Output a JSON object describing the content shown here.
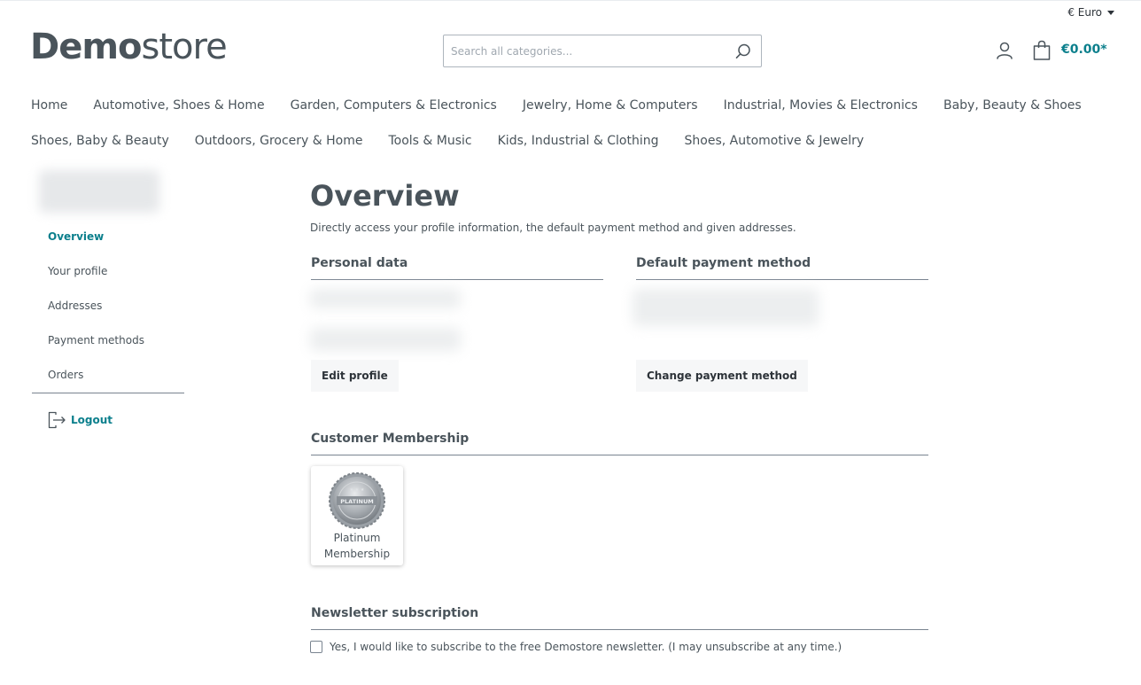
{
  "header": {
    "currency_label": "€ Euro",
    "logo_bold": "Demo",
    "logo_light": "store",
    "search_placeholder": "Search all categories...",
    "cart_total": "€0.00*"
  },
  "nav": {
    "row1": [
      "Home",
      "Automotive, Shoes & Home",
      "Garden, Computers & Electronics",
      "Jewelry, Home & Computers",
      "Industrial, Movies & Electronics",
      "Baby, Beauty & Shoes"
    ],
    "row2": [
      "Shoes, Baby & Beauty",
      "Outdoors, Grocery & Home",
      "Tools & Music",
      "Kids, Industrial & Clothing",
      "Shoes, Automotive & Jewelry"
    ]
  },
  "sidebar": {
    "items": [
      {
        "label": "Overview",
        "active": true
      },
      {
        "label": "Your profile",
        "active": false
      },
      {
        "label": "Addresses",
        "active": false
      },
      {
        "label": "Payment methods",
        "active": false
      },
      {
        "label": "Orders",
        "active": false
      }
    ],
    "logout_label": "Logout"
  },
  "main": {
    "title": "Overview",
    "intro": "Directly access your profile information, the default payment method and given addresses.",
    "personal_data_title": "Personal data",
    "edit_profile_label": "Edit profile",
    "payment_title": "Default payment method",
    "change_payment_label": "Change payment method",
    "membership_title": "Customer Membership",
    "membership_badge_text": "PLATINUM",
    "membership_name": "Platinum\nMembership",
    "newsletter_title": "Newsletter subscription",
    "newsletter_text": "Yes, I would like to subscribe to the free Demostore newsletter. (I may unsubscribe at any time.)"
  },
  "colors": {
    "accent": "#0b7f8c",
    "text": "#4a545b",
    "divider": "#798490"
  }
}
